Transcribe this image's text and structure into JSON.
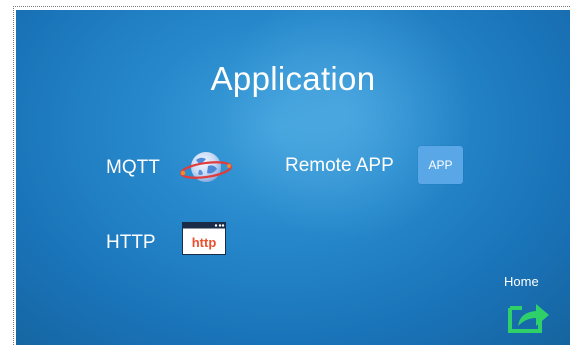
{
  "screen": {
    "title": "Application",
    "background_color": "#2688cb"
  },
  "items": {
    "mqtt": {
      "label": "MQTT",
      "icon": "globe-orbit-icon"
    },
    "remote_app": {
      "label": "Remote APP",
      "button_text": "APP",
      "icon": "app-icon"
    },
    "http": {
      "label": "HTTP",
      "icon_text": "http",
      "icon": "http-browser-icon"
    }
  },
  "home": {
    "label": "Home",
    "icon": "home-share-icon",
    "icon_color": "#2fd06a"
  }
}
